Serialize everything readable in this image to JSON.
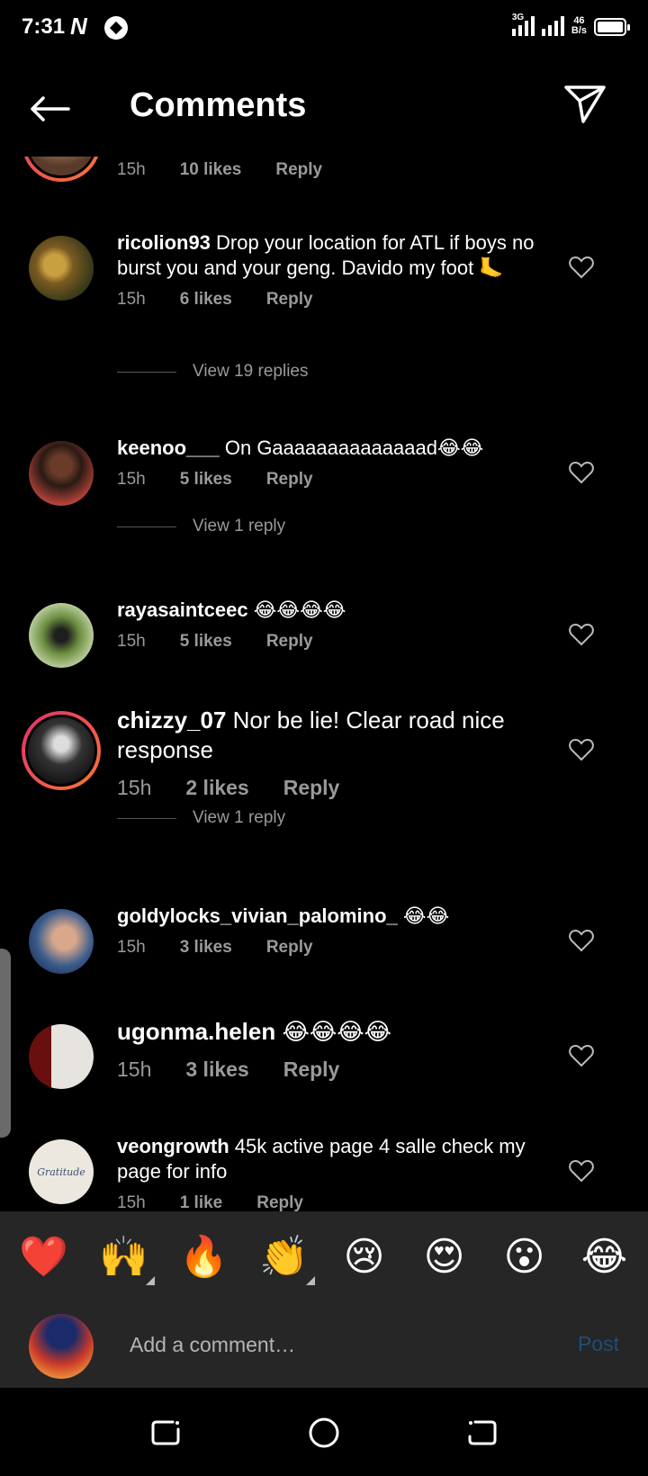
{
  "status_bar": {
    "time": "7:31",
    "app_badge": "N",
    "network_type": "3G",
    "speed_value": "46",
    "speed_unit": "B/s"
  },
  "header": {
    "title": "Comments"
  },
  "partial_comment": {
    "time": "15h",
    "likes": "10 likes",
    "reply_label": "Reply"
  },
  "comments": [
    {
      "username": "ricolion93",
      "text": "Drop your location for ATL  if boys no burst you and your geng.  Davido my foot 🦶",
      "time": "15h",
      "likes": "6 likes",
      "reply_label": "Reply",
      "view_replies": "View 19 replies"
    },
    {
      "username": "keenoo___",
      "text": "On Gaaaaaaaaaaaaaad😂😂",
      "time": "15h",
      "likes": "5 likes",
      "reply_label": "Reply",
      "view_replies": "View 1 reply"
    },
    {
      "username": "rayasaintceec",
      "text": "😂😂😂😂",
      "time": "15h",
      "likes": "5 likes",
      "reply_label": "Reply"
    },
    {
      "username": "chizzy_07",
      "text": "Nor be lie! Clear road nice response",
      "time": "15h",
      "likes": "2 likes",
      "reply_label": "Reply",
      "view_replies": "View 1 reply"
    },
    {
      "username": "goldylocks_vivian_palomino_",
      "text": "😂😂",
      "time": "15h",
      "likes": "3 likes",
      "reply_label": "Reply"
    },
    {
      "username": "ugonma.helen",
      "text": "😂😂😂😂",
      "time": "15h",
      "likes": "3 likes",
      "reply_label": "Reply"
    },
    {
      "username": "veongrowth",
      "text": "45k active page 4 salle check my page for info",
      "time": "15h",
      "likes": "1 like",
      "reply_label": "Reply",
      "avatar_text": "Gratitude"
    }
  ],
  "reactions": [
    "❤️",
    "🙌",
    "🔥",
    "👏",
    "😢",
    "😍",
    "😮",
    "😂"
  ],
  "composer": {
    "placeholder": "Add a comment…",
    "post_label": "Post"
  }
}
